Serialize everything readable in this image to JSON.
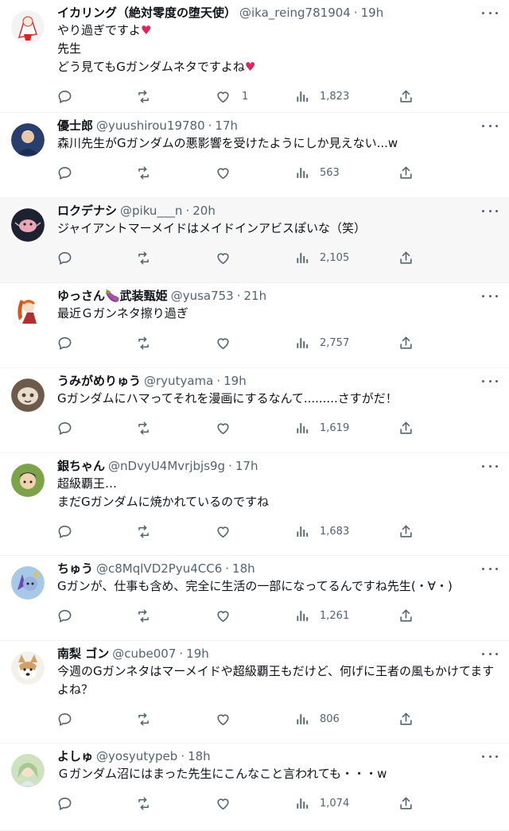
{
  "colors": {
    "text": "#0f1419",
    "secondary": "#536471",
    "border": "#eff3f4",
    "heart": "#e0245e"
  },
  "icons": {
    "reply": "reply-icon",
    "retweet": "retweet-icon",
    "like": "heart-icon",
    "views": "views-icon",
    "share": "share-icon",
    "more": "more-icon"
  },
  "tweets": [
    {
      "name": "イカリング（絶対零度の堕天使）",
      "handle": "@ika_reing781904",
      "time": "19h",
      "text": "やり過ぎですよ♥\n先生\nどう見てもGガンダムネタですよね♥",
      "likes": "1",
      "views": "1,823"
    },
    {
      "name": "優士郎",
      "handle": "@yuushirou19780",
      "time": "17h",
      "text": "森川先生がGガンダムの悪影響を受けたようにしか見えない...w",
      "likes": "",
      "views": "563"
    },
    {
      "name": "ロクデナシ",
      "handle": "@piku___n",
      "time": "20h",
      "text": "ジャイアントマーメイドはメイドインアビスぽいな（笑）",
      "likes": "",
      "views": "2,105"
    },
    {
      "name": "ゆっさん🍆武装甄姫",
      "handle": "@yusa753",
      "time": "21h",
      "text": "最近Ｇガンネタ擦り過ぎ",
      "likes": "",
      "views": "2,757"
    },
    {
      "name": "うみがめりゅう",
      "handle": "@ryutyama",
      "time": "19h",
      "text": "Gガンダムにハマってそれを漫画にするなんて.........さすがだ！",
      "likes": "",
      "views": "1,619"
    },
    {
      "name": "銀ちゃん",
      "handle": "@nDvyU4Mvrjbjs9g",
      "time": "17h",
      "text": "超級覇王…\nまだGガンダムに焼かれているのですね",
      "likes": "",
      "views": "1,683"
    },
    {
      "name": "ちゅう",
      "handle": "@c8MqlVD2Pyu4CC6",
      "time": "18h",
      "text": "Gガンが、仕事も含め、完全に生活の一部になってるんですね先生(・∀・)",
      "likes": "",
      "views": "1,261"
    },
    {
      "name": "南梨 ゴン",
      "handle": "@cube007",
      "time": "19h",
      "text": "今週のGガンネタはマーメイドや超級覇王もだけど、何げに王者の風もかけてますよね？",
      "likes": "",
      "views": "806"
    },
    {
      "name": "よしゅ",
      "handle": "@yosyutypeb",
      "time": "18h",
      "text": "Ｇガンダム沼にはまった先生にこんなこと言われても・・・w",
      "likes": "",
      "views": "1,074"
    }
  ]
}
